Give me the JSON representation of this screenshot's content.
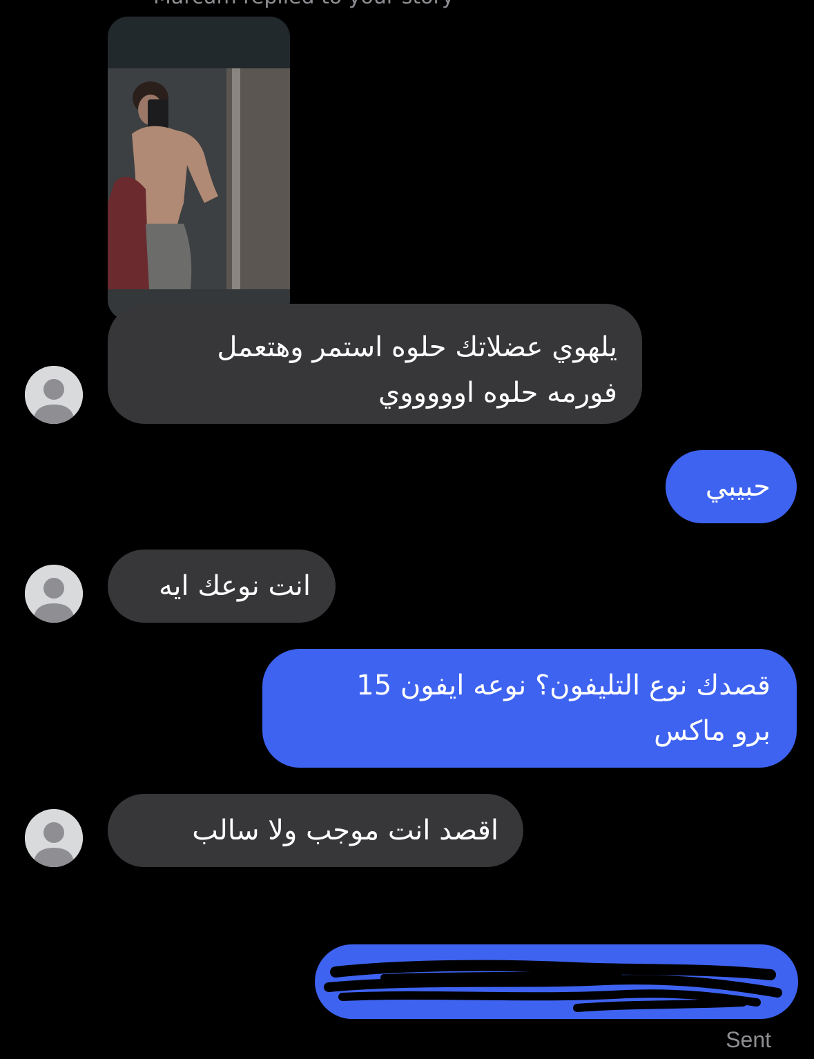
{
  "header": {
    "story_reply_caption": "Marcum replied to your story"
  },
  "messages": [
    {
      "direction": "incoming",
      "type": "story-image",
      "description_icon": "shirtless-mirror-selfie-image"
    },
    {
      "direction": "incoming",
      "text_line1": "يلهوي عضلاتك حلوه استمر وهتعمل",
      "text_line2": "فورمه حلوه اوووووي"
    },
    {
      "direction": "outgoing",
      "text": "حبيبي"
    },
    {
      "direction": "incoming",
      "text": "انت نوعك ايه"
    },
    {
      "direction": "outgoing",
      "text_line1": "قصدك نوع التليفون؟ نوعه ايفون 15",
      "text_line2": "برو ماكس"
    },
    {
      "direction": "incoming",
      "text": "اقصد انت موجب ولا سالب"
    },
    {
      "direction": "outgoing",
      "type": "redacted"
    }
  ],
  "status": {
    "sent_label": "Sent"
  },
  "colors": {
    "background": "#000000",
    "incoming_bubble": "#37373a",
    "outgoing_bubble": "#3e63f1",
    "meta_text": "#8e8e93"
  }
}
